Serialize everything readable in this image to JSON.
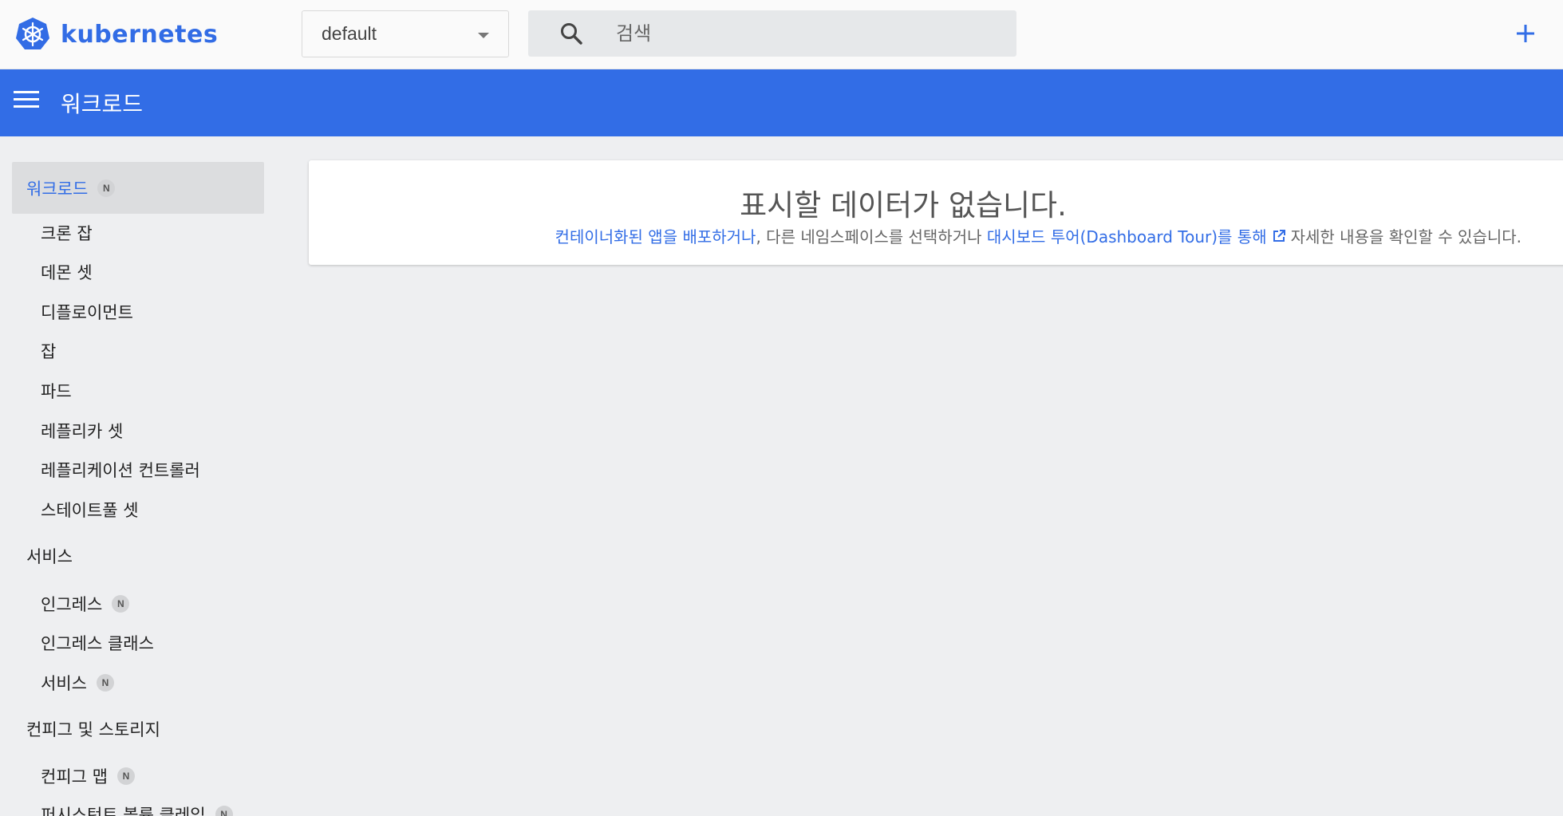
{
  "header": {
    "brand": "kubernetes",
    "namespace": "default",
    "search_placeholder": "검색"
  },
  "bluebar": {
    "title": "워크로드"
  },
  "sidebar": {
    "active": {
      "label": "워크로드",
      "badge": "N"
    },
    "workloads": [
      {
        "label": "크론 잡"
      },
      {
        "label": "데몬 셋"
      },
      {
        "label": "디플로이먼트"
      },
      {
        "label": "잡"
      },
      {
        "label": "파드"
      },
      {
        "label": "레플리카 셋"
      },
      {
        "label": "레플리케이션 컨트롤러"
      },
      {
        "label": "스테이트풀 셋"
      }
    ],
    "services_group": "서비스",
    "services": [
      {
        "label": "인그레스",
        "badge": "N"
      },
      {
        "label": "인그레스 클래스"
      },
      {
        "label": "서비스",
        "badge": "N"
      }
    ],
    "config_group": "컨피그 및 스토리지",
    "config": [
      {
        "label": "컨피그 맵",
        "badge": "N"
      },
      {
        "label": "퍼시스턴트 볼륨 클레임",
        "badge": "N"
      }
    ]
  },
  "empty_state": {
    "title": "표시할 데이터가 없습니다.",
    "deploy_link": "컨테이너화된 앱을 배포하거나",
    "middle_text": ", 다른 네임스페이스를 선택하거나 ",
    "tour_link": "대시보드 투어(Dashboard Tour)를 통해",
    "end_text": "자세한 내용을 확인할 수 있습니다."
  },
  "colors": {
    "brand": "#326de6",
    "background": "#eeeff1"
  }
}
